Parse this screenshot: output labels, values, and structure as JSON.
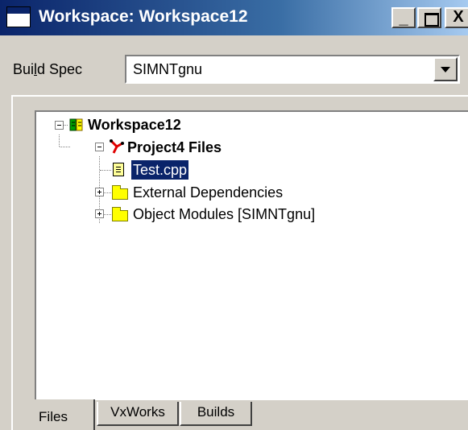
{
  "window": {
    "title": "Workspace: Workspace12",
    "min_glyph": "_",
    "close_glyph": "X"
  },
  "build_spec": {
    "label_pre": "Bui",
    "label_accel": "l",
    "label_post": "d Spec",
    "value": "SIMNTgnu"
  },
  "tree": {
    "workspace": "Workspace12",
    "project": "Project4 Files",
    "file": "Test.cpp",
    "folder1": "External Dependencies",
    "folder2": "Object Modules [SIMNTgnu]"
  },
  "tabs": {
    "files": "Files",
    "vxworks": "VxWorks",
    "builds": "Builds"
  },
  "colors": {
    "title_gradient_start": "#0a246a",
    "selection": "#0a246a",
    "face": "#d4d0c8",
    "folder": "#ffff00"
  },
  "icons": [
    "app-window-icon",
    "workspace-book-icon",
    "project-icon",
    "file-icon",
    "folder-icon"
  ]
}
